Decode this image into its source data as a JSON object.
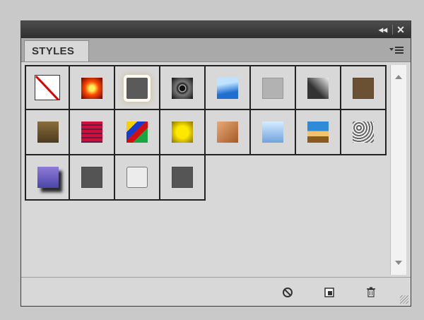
{
  "window": {
    "collapse_glyph": "◂◂",
    "close_glyph": "✕"
  },
  "tabs": [
    {
      "label": "STYLES"
    }
  ],
  "panel_menu_icon": "panel-menu-icon",
  "styles": [
    {
      "id": "default-none",
      "icon": "no-style-swatch"
    },
    {
      "id": "red-glow",
      "colors": [
        "#ffef5a",
        "#ff4a00",
        "#6a0000"
      ]
    },
    {
      "id": "gray-outer-glow",
      "colors": [
        "#5a5a5a",
        "#fffaf0"
      ]
    },
    {
      "id": "dark-chrome",
      "colors": [
        "#c9c9c9",
        "#111111"
      ]
    },
    {
      "id": "blue-sky",
      "colors": [
        "#bfe3ff",
        "#1f6fd1"
      ]
    },
    {
      "id": "light-gray",
      "colors": [
        "#b2b2b2"
      ]
    },
    {
      "id": "dark-metal",
      "colors": [
        "#eeeeee",
        "#333333"
      ]
    },
    {
      "id": "brown",
      "colors": [
        "#6b5133"
      ]
    },
    {
      "id": "brown-gold",
      "colors": [
        "#8a6d3d",
        "#4d3a1e"
      ]
    },
    {
      "id": "red-stripes",
      "colors": [
        "#d0103a",
        "#6a1a40"
      ]
    },
    {
      "id": "multicolor",
      "colors": [
        "#f7d000",
        "#1a3ccd",
        "#d01010",
        "#19a640"
      ]
    },
    {
      "id": "gold-frame",
      "colors": [
        "#ffe800",
        "#8a7200"
      ]
    },
    {
      "id": "copper-sand",
      "colors": [
        "#e7a978",
        "#a45a27"
      ]
    },
    {
      "id": "pale-sky",
      "colors": [
        "#d6ecff",
        "#6fa3dc"
      ]
    },
    {
      "id": "sky-desert",
      "colors": [
        "#2e8bd8",
        "#f3c26f",
        "#8a5a1e"
      ]
    },
    {
      "id": "gray-texture",
      "colors": [
        "#f0f0f0",
        "#666666"
      ]
    },
    {
      "id": "violet-drop-shadow",
      "colors": [
        "#8f7bd8",
        "#4a45a8"
      ]
    },
    {
      "id": "dark-gray",
      "colors": [
        "#545454"
      ]
    },
    {
      "id": "outline-light",
      "colors": [
        "#f0f0f0",
        "#777777"
      ]
    },
    {
      "id": "dark-gray-2",
      "colors": [
        "#555555"
      ]
    }
  ],
  "bottom_icons": [
    {
      "name": "break-link-icon",
      "glyph": "⊘"
    },
    {
      "name": "new-graphic-style-icon",
      "glyph": "⧉"
    },
    {
      "name": "delete-style-icon",
      "glyph": "🗑"
    }
  ]
}
